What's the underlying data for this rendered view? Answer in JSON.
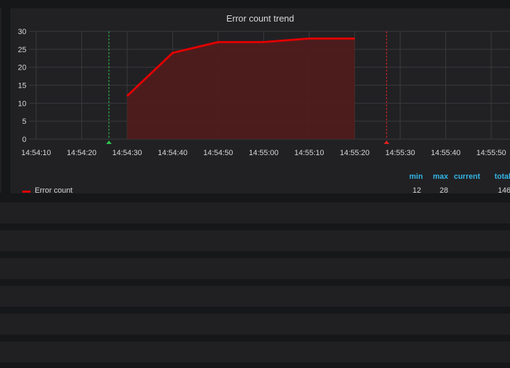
{
  "panel": {
    "title": "Error count trend"
  },
  "legend": {
    "headers": {
      "min": "min",
      "max": "max",
      "current": "current",
      "total": "total"
    },
    "series_name": "Error count",
    "min": "12",
    "max": "28",
    "current": "",
    "total": "146"
  },
  "colors": {
    "series": "#e00000",
    "fill": "#4f1c1e",
    "start_marker": "#2fc24d",
    "end_marker": "#e02020",
    "legend_header": "#33b5e5"
  },
  "chart_data": {
    "type": "area",
    "title": "Error count trend",
    "xlabel": "",
    "ylabel": "",
    "ylim": [
      0,
      30
    ],
    "yticks": [
      "0",
      "5",
      "10",
      "15",
      "20",
      "25",
      "30"
    ],
    "xticks": [
      "14:54:10",
      "14:54:20",
      "14:54:30",
      "14:54:40",
      "14:54:50",
      "14:55:00",
      "14:55:10",
      "14:55:20",
      "14:55:30",
      "14:55:40",
      "14:55:50"
    ],
    "series": [
      {
        "name": "Error count",
        "x": [
          "14:54:30",
          "14:54:40",
          "14:54:50",
          "14:55:00",
          "14:55:10",
          "14:55:20"
        ],
        "values": [
          12,
          24,
          27,
          27,
          28,
          28
        ]
      }
    ],
    "markers": [
      {
        "x": "14:54:26",
        "kind": "start"
      },
      {
        "x": "14:55:27",
        "kind": "end"
      }
    ],
    "grid": true
  }
}
